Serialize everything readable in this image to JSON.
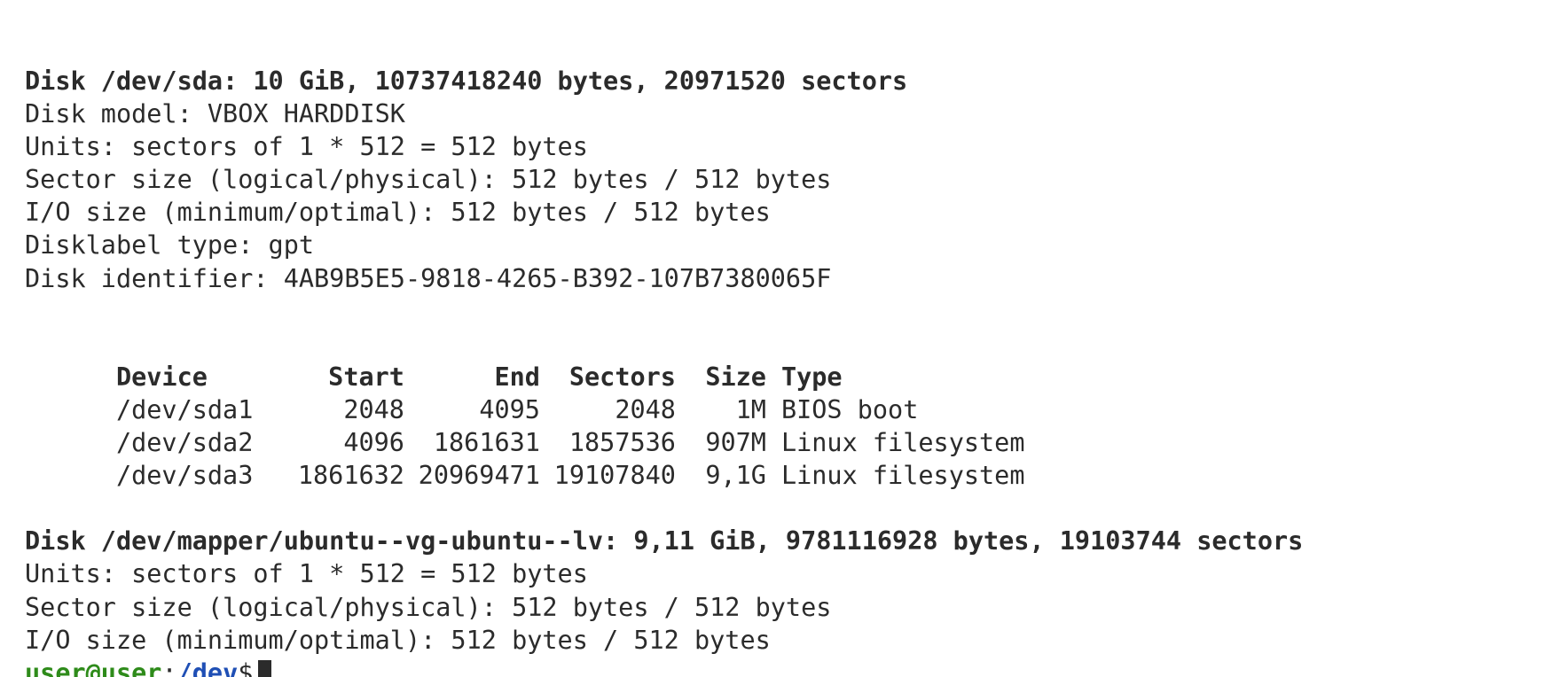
{
  "disk1": {
    "header": "Disk /dev/sda: 10 GiB, 10737418240 bytes, 20971520 sectors",
    "model": "Disk model: VBOX HARDDISK",
    "units": "Units: sectors of 1 * 512 = 512 bytes",
    "sector_size": "Sector size (logical/physical): 512 bytes / 512 bytes",
    "io_size": "I/O size (minimum/optimal): 512 bytes / 512 bytes",
    "label_type": "Disklabel type: gpt",
    "identifier": "Disk identifier: 4AB9B5E5-9818-4265-B392-107B7380065F"
  },
  "partition_table": {
    "columns": [
      "Device",
      "Start",
      "End",
      "Sectors",
      "Size",
      "Type"
    ],
    "rows": [
      [
        "/dev/sda1",
        "2048",
        "4095",
        "2048",
        "1M",
        "BIOS boot"
      ],
      [
        "/dev/sda2",
        "4096",
        "1861631",
        "1857536",
        "907M",
        "Linux filesystem"
      ],
      [
        "/dev/sda3",
        "1861632",
        "20969471",
        "19107840",
        "9,1G",
        "Linux filesystem"
      ]
    ]
  },
  "disk2": {
    "header": "Disk /dev/mapper/ubuntu--vg-ubuntu--lv: 9,11 GiB, 9781116928 bytes, 19103744 sectors",
    "units": "Units: sectors of 1 * 512 = 512 bytes",
    "sector_size": "Sector size (logical/physical): 512 bytes / 512 bytes",
    "io_size": "I/O size (minimum/optimal): 512 bytes / 512 bytes"
  },
  "prompt": {
    "user_host": "user@user",
    "separator": ":",
    "path": "/dev",
    "sign": "$"
  },
  "colors": {
    "text": "#2b2b2b",
    "prompt_user": "#2e8b1a",
    "prompt_path": "#1f4fb5",
    "background": "#ffffff"
  }
}
